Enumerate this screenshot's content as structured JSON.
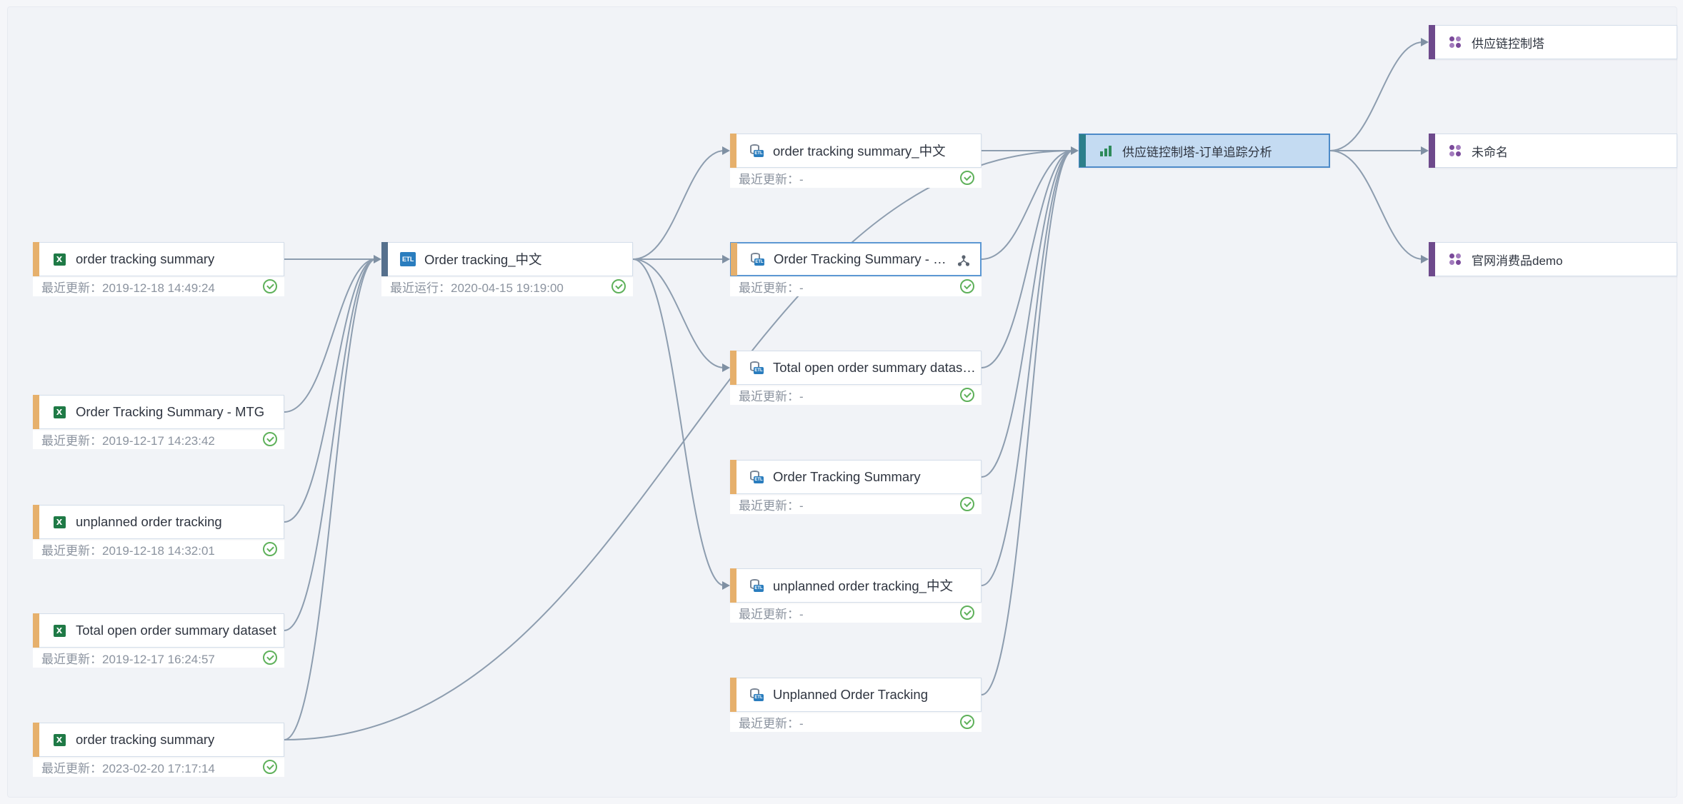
{
  "colors": {
    "source_bar": "#e6b06c",
    "etl_bar": "#56708d",
    "dataset_bar": "#e6b06c",
    "dashboard_bar": "#2c7f8a",
    "app_bar": "#6e4a8c",
    "selected_border": "#5c98d3",
    "highlight_fill": "#c4dbf2",
    "success": "#5fb15b",
    "edge": "#8d9daf"
  },
  "lineage": {
    "sources": [
      {
        "id": "s1",
        "icon": "excel-icon",
        "label": "order tracking summary",
        "meta": "最近更新：2019-12-18 14:49:24",
        "status": "success"
      },
      {
        "id": "s2",
        "icon": "excel-icon",
        "label": "Order Tracking Summary - MTG",
        "meta": "最近更新：2019-12-17 14:23:42",
        "status": "success"
      },
      {
        "id": "s3",
        "icon": "excel-icon",
        "label": "unplanned order tracking",
        "meta": "最近更新：2019-12-18 14:32:01",
        "status": "success"
      },
      {
        "id": "s4",
        "icon": "excel-icon",
        "label": "Total open order summary dataset",
        "meta": "最近更新：2019-12-17 16:24:57",
        "status": "success"
      },
      {
        "id": "s5",
        "icon": "excel-icon",
        "label": "order tracking summary",
        "meta": "最近更新：2023-02-20 17:17:14",
        "status": "success"
      }
    ],
    "etl": {
      "id": "e1",
      "icon": "etl-icon",
      "label": "Order tracking_中文",
      "meta": "最近运行：2020-04-15 19:19:00",
      "status": "success"
    },
    "datasets": [
      {
        "id": "d1",
        "icon": "etl-dataset-icon",
        "label": "order tracking summary_中文",
        "meta": "最近更新：-",
        "status": "success"
      },
      {
        "id": "d2",
        "icon": "etl-dataset-icon",
        "label": "Order Tracking Summary - …",
        "meta": "最近更新：-",
        "status": "success",
        "selected": true,
        "extra_icon": "share-icon"
      },
      {
        "id": "d3",
        "icon": "etl-dataset-icon",
        "label": "Total open order summary datas…",
        "meta": "最近更新：-",
        "status": "success"
      },
      {
        "id": "d4",
        "icon": "etl-dataset-icon",
        "label": "Order Tracking Summary",
        "meta": "最近更新：-",
        "status": "success"
      },
      {
        "id": "d5",
        "icon": "etl-dataset-icon",
        "label": "unplanned order tracking_中文",
        "meta": "最近更新：-",
        "status": "success"
      },
      {
        "id": "d6",
        "icon": "etl-dataset-icon",
        "label": "Unplanned Order Tracking",
        "meta": "最近更新：-",
        "status": "success"
      }
    ],
    "dashboard": {
      "id": "b1",
      "icon": "bar-chart-icon",
      "label": "供应链控制塔-订单追踪分析",
      "highlighted": true
    },
    "apps": [
      {
        "id": "a1",
        "icon": "app-icon",
        "label": "供应链控制塔"
      },
      {
        "id": "a2",
        "icon": "app-icon",
        "label": "未命名"
      },
      {
        "id": "a3",
        "icon": "app-icon",
        "label": "官网消费品demo"
      }
    ]
  }
}
